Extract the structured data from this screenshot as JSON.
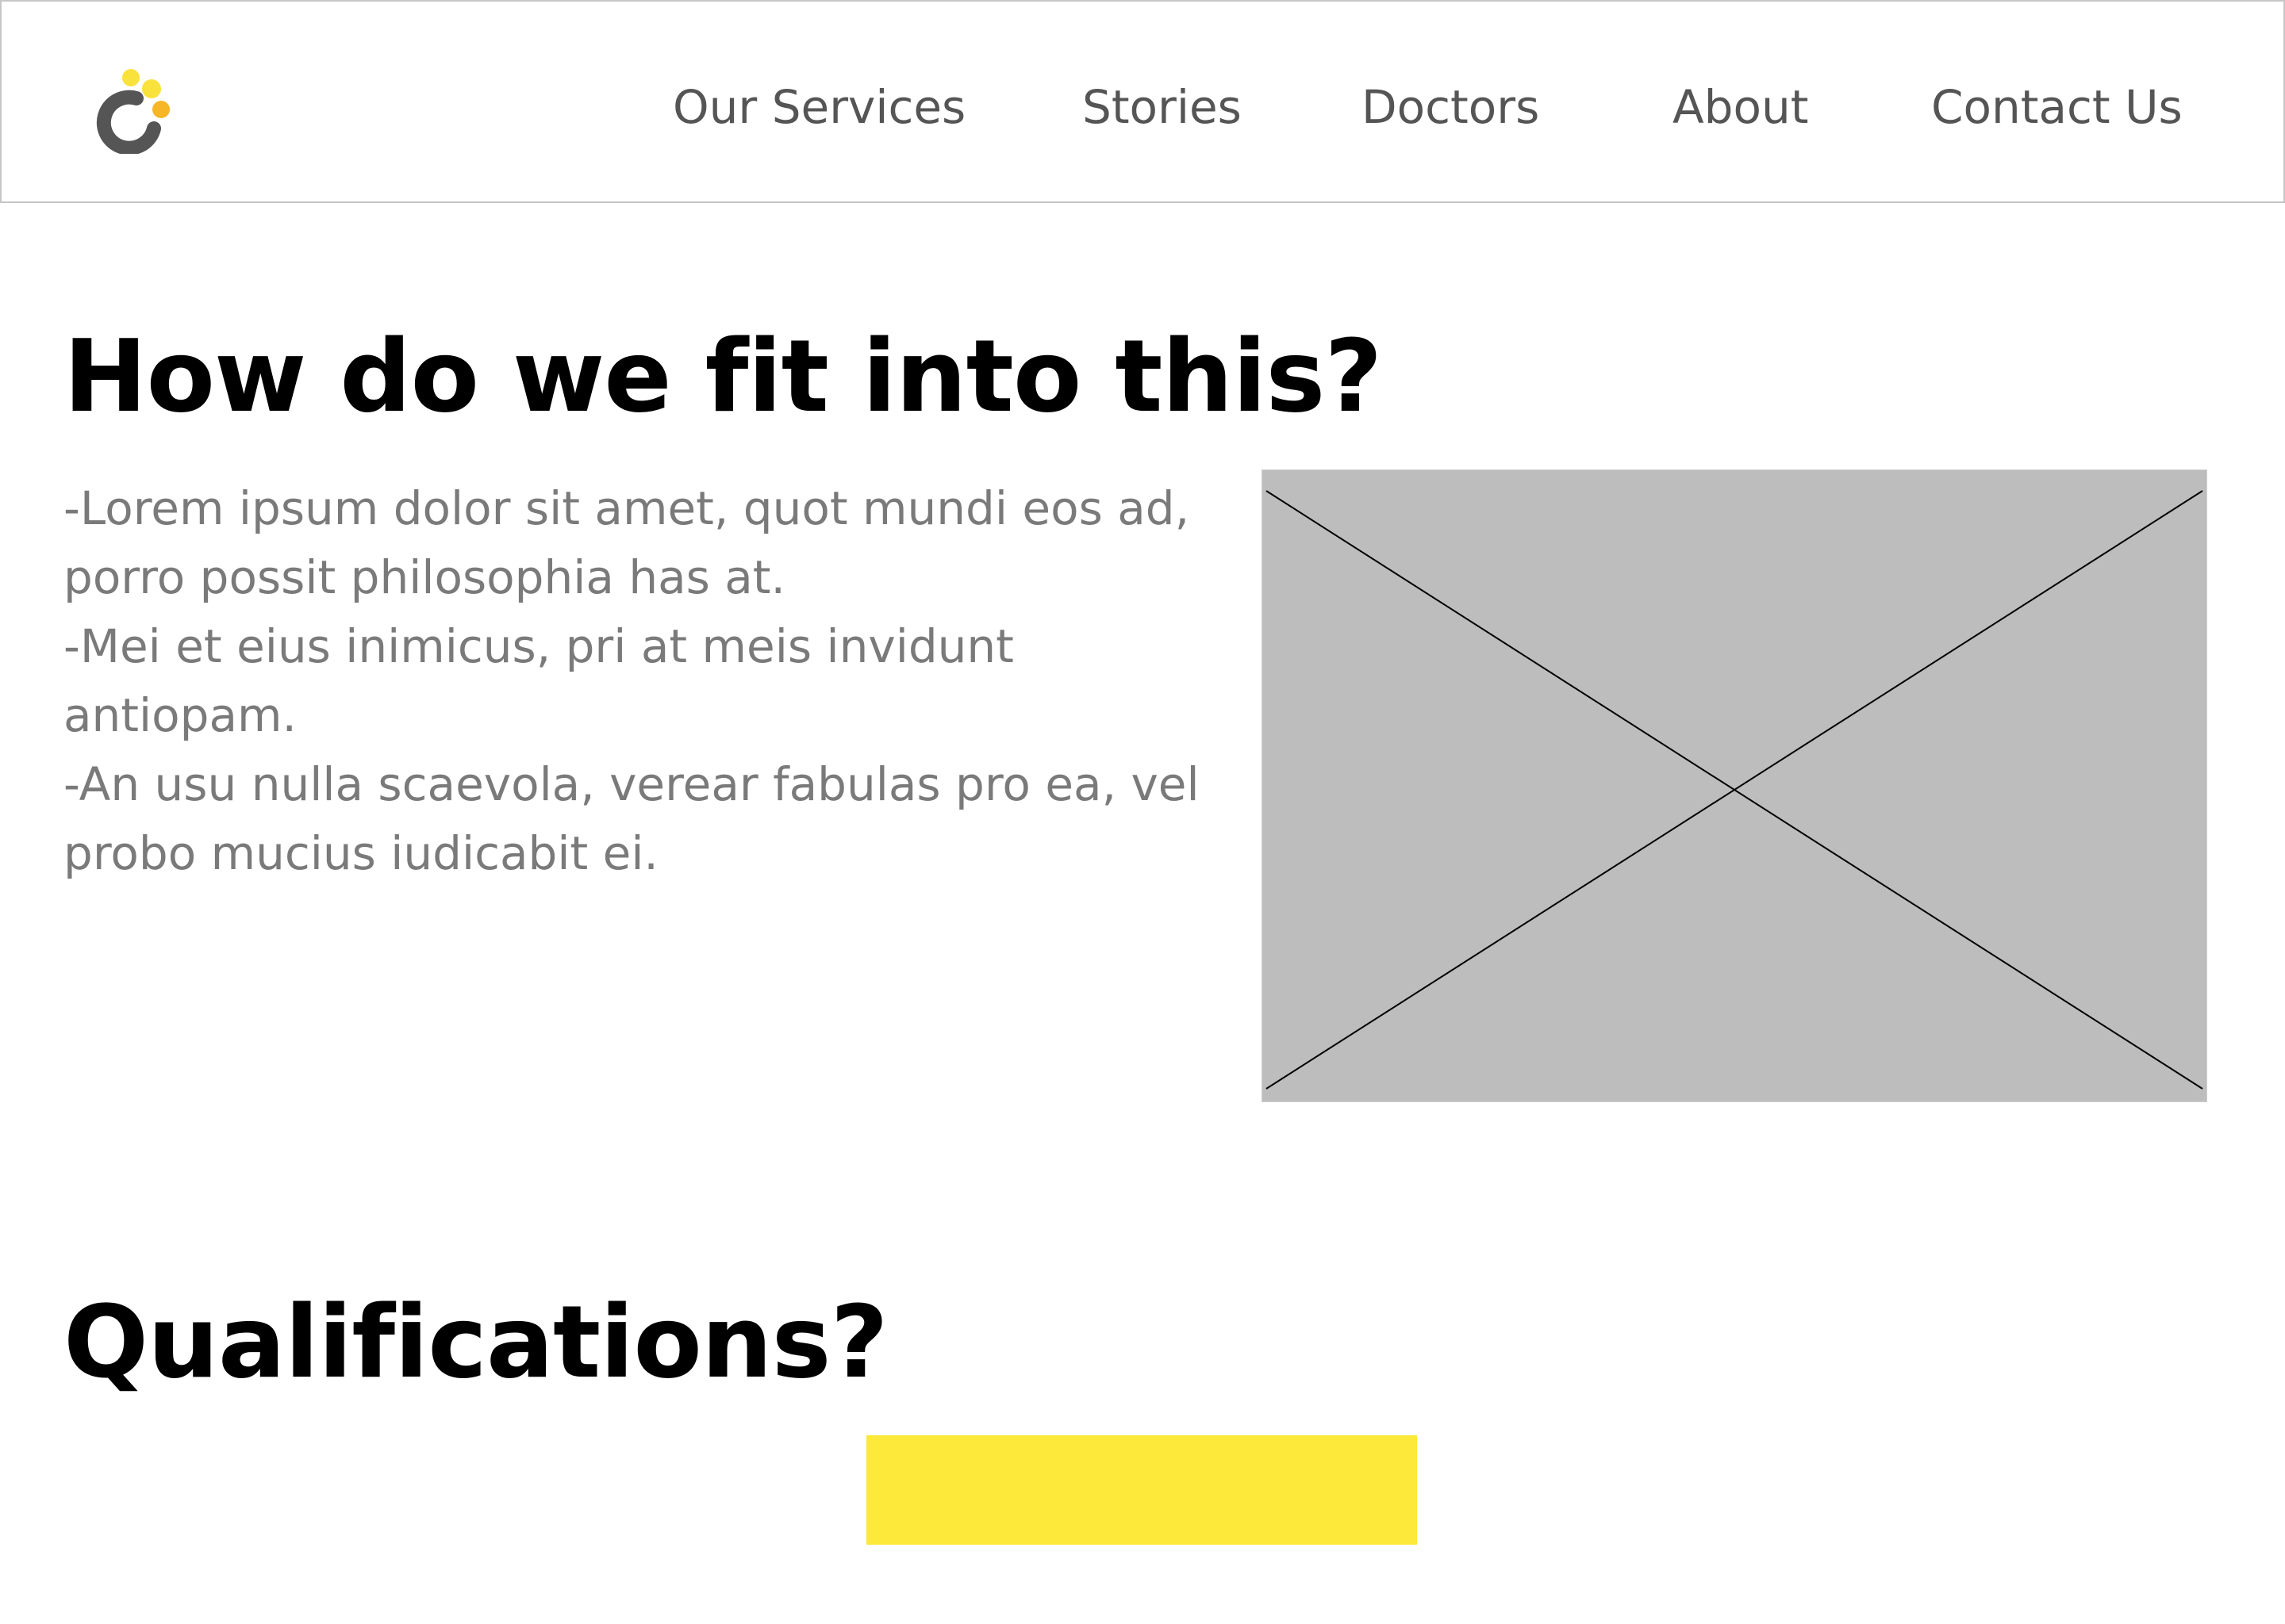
{
  "brand": {
    "logo_icon": "brand-logo-icon",
    "colors": {
      "arc": "#555555",
      "dot_yellow": "#f9e23c",
      "dot_orange": "#f6b626"
    }
  },
  "nav": {
    "items": [
      {
        "label": "Our Services"
      },
      {
        "label": "Stories"
      },
      {
        "label": "Doctors"
      },
      {
        "label": "About"
      },
      {
        "label": "Contact Us"
      }
    ]
  },
  "main": {
    "section_fit": {
      "title": "How do we fit into this?",
      "lines": [
        "-Lorem ipsum dolor sit amet, quot mundi eos ad,",
        "porro possit philosophia has at.",
        "-Mei et eius inimicus, pri at meis invidunt",
        "antiopam.",
        "-An usu nulla scaevola, verear fabulas pro ea, vel",
        "probo mucius iudicabit ei."
      ],
      "image_icon": "image-placeholder-icon"
    },
    "section_qual": {
      "title": "Qualifications?"
    }
  },
  "colors": {
    "nav_text": "#555555",
    "body_text": "#7a7a7a",
    "heading": "#000000",
    "placeholder_fill": "#bdbdbd",
    "accent_yellow": "#fde93a"
  }
}
